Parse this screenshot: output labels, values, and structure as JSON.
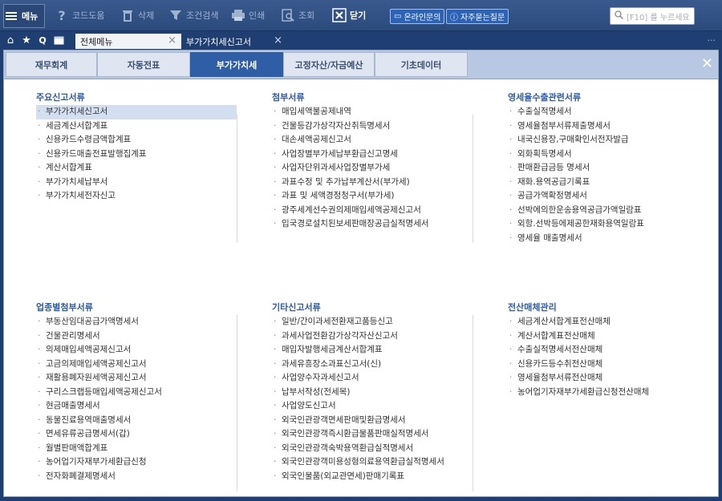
{
  "toolbar": {
    "menu_label": "메뉴",
    "code_help": "코드도움",
    "delete": "삭제",
    "condition_search": "조건검색",
    "print": "인쇄",
    "view": "조회",
    "close": "닫기",
    "online_inquiry": "온라인문의",
    "faq": "자주묻는질문",
    "search_placeholder": "[F10] 를 누르세요"
  },
  "window_tabs": [
    {
      "label": "전체메뉴"
    },
    {
      "label": "부가가치세신고서"
    }
  ],
  "more_label": "...",
  "category_tabs": [
    {
      "label": "재무회계"
    },
    {
      "label": "자동전표"
    },
    {
      "label": "부가가치세"
    },
    {
      "label": "고정자산/자금예산"
    },
    {
      "label": "기초데이터"
    }
  ],
  "sections": [
    {
      "title": "주요신고서류",
      "items": [
        "부가가치세신고서",
        "세금계산서합계표",
        "신용카드수령금액합계표",
        "신용카드매출전표발행집계표",
        "계산서합계표",
        "부가가치세납부서",
        "부가가치세전자신고"
      ]
    },
    {
      "title": "첨부서류",
      "items": [
        "매입세액불공제내역",
        "건물등감가상각자산취득명세서",
        "대손세액공제신고서",
        "사업장별부가세납부환급신고명세",
        "사업자단위과세사업장별부가세",
        "과표수정 및 추가납부계산서(부가세)",
        "과표 및 세액경정청구서(부가세)",
        "광주세계선수권의제매입세액공제신고서",
        "입국경로설치된보세판매장공급실적명세서"
      ]
    },
    {
      "title": "영세율수출관련서류",
      "items": [
        "수출실적명세서",
        "영세율첨부서류제출명세서",
        "내국신용장,구매확인서전자발급",
        "외화획득명세서",
        "판매환급금등 명세서",
        "재화.용역공급기록표",
        "공급가액확정명세서",
        "선박에의한운송용역공급가액일람표",
        "외항.선박등에제공한재화용역일람표",
        "영세율 매출명세서"
      ]
    },
    {
      "title": "업종별첨부서류",
      "items": [
        "부동산임대공급가액명세서",
        "건물관리명세서",
        "의제매입세액공제신고서",
        "고금의제매입세액공제신고서",
        "재활용폐자원세액공제신고서",
        "구리스크랩등매입세액공제신고서",
        "현금매출명세서",
        "동물진료용역매출명세서",
        "면세유류공급명세서(갑)",
        "월별판매액합계표",
        "농어업기자재부가세환급신청",
        "전자화폐결제명세서"
      ]
    },
    {
      "title": "기타신고서류",
      "items": [
        "일반/간이과세전환재고품등신고",
        "과세사업전환감가상각자산신고서",
        "매입자발행세금계산서합계표",
        "과세유흥장소과표신고서(신)",
        "사업양수자과세신고서",
        "납부서작성(전세목)",
        "사업양도신고서",
        "외국인관광객면세판매및환급명세서",
        "외국인관광객즉시환급물품판매실적명세서",
        "외국인관광객숙박용역환급실적명세서",
        "외국인관광객미용성형의료용역환급실적명세서",
        "외국인물품(외교관면세)판매기록표"
      ]
    },
    {
      "title": "전산매체관리",
      "items": [
        "세금계산서합계표전산매체",
        "계산서합계표전산매체",
        "수출실적명세서전산매체",
        "신용카드등수취전산매체",
        "영세율첨부서류전산매체",
        "농어업기자재부가세환급신청전산매체"
      ]
    }
  ]
}
